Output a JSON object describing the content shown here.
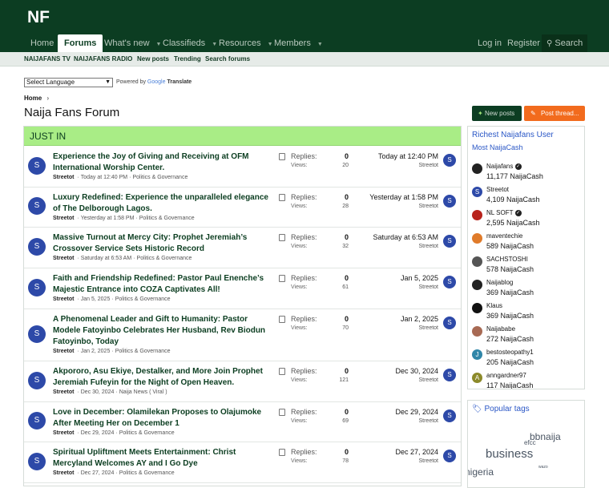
{
  "logo": "NF",
  "nav": {
    "home": "Home",
    "forums": "Forums",
    "whats_new": "What's new",
    "classifieds": "Classifieds",
    "resources": "Resources",
    "members": "Members",
    "login": "Log in",
    "register": "Register",
    "search": "Search"
  },
  "subnav": [
    "NAIJAFANS TV",
    "NAIJAFANS RADIO",
    "New posts",
    "Trending",
    "Search forums"
  ],
  "language": {
    "selected": "Select Language",
    "powered": "Powered by",
    "google": "Google",
    "translate": "Translate"
  },
  "breadcrumb": "Home",
  "page_title": "Naija Fans Forum",
  "buttons": {
    "new_posts": "New posts",
    "post_thread": "Post thread..."
  },
  "block_title": "JUST IN",
  "labels": {
    "replies": "Replies:",
    "views": "Views:"
  },
  "threads": [
    {
      "title": "Experience the Joy of Giving and Receiving at OFM International Worship Center.",
      "author": "Streetot",
      "date": "Today at 12:40 PM",
      "forum": "Politics & Governance",
      "replies": "0",
      "views": "20",
      "last": "Today at 12:40 PM",
      "last_user": "Streetot",
      "avatar": "S"
    },
    {
      "title": "Luxury Redefined: Experience the unparalleled elegance of The Delborough Lagos.",
      "author": "Streetot",
      "date": "Yesterday at 1:58 PM",
      "forum": "Politics & Governance",
      "replies": "0",
      "views": "28",
      "last": "Yesterday at 1:58 PM",
      "last_user": "Streetot",
      "avatar": "S"
    },
    {
      "title": "Massive Turnout at Mercy City: Prophet Jeremiah’s Crossover Service Sets Historic Record",
      "author": "Streetot",
      "date": "Saturday at 6:53 AM",
      "forum": "Politics & Governance",
      "replies": "0",
      "views": "32",
      "last": "Saturday at 6:53 AM",
      "last_user": "Streetot",
      "avatar": "S"
    },
    {
      "title": "Faith and Friendship Redefined: Pastor Paul Enenche’s Majestic Entrance into COZA Captivates All!",
      "author": "Streetot",
      "date": "Jan 5, 2025",
      "forum": "Politics & Governance",
      "replies": "0",
      "views": "61",
      "last": "Jan 5, 2025",
      "last_user": "Streetot",
      "avatar": "S"
    },
    {
      "title": "A Phenomenal Leader and Gift to Humanity: Pastor Modele Fatoyinbo Celebrates Her Husband, Rev Biodun Fatoyinbo, Today",
      "author": "Streetot",
      "date": "Jan 2, 2025",
      "forum": "Politics & Governance",
      "replies": "0",
      "views": "70",
      "last": "Jan 2, 2025",
      "last_user": "Streetot",
      "avatar": "S"
    },
    {
      "title": "Akpororo, Asu Ekiye, Destalker, and More Join Prophet Jeremiah Fufeyin for the Night of Open Heaven.",
      "author": "Streetot",
      "date": "Dec 30, 2024",
      "forum": "Naija News ( Viral )",
      "replies": "0",
      "views": "121",
      "last": "Dec 30, 2024",
      "last_user": "Streetot",
      "avatar": "S"
    },
    {
      "title": "Love in December: Olamilekan Proposes to Olajumoke After Meeting Her on December 1",
      "author": "Streetot",
      "date": "Dec 29, 2024",
      "forum": "Politics & Governance",
      "replies": "0",
      "views": "69",
      "last": "Dec 29, 2024",
      "last_user": "Streetot",
      "avatar": "S"
    },
    {
      "title": "Spiritual Upliftment Meets Entertainment: Christ Mercyland Welcomes AY and I Go Dye",
      "author": "Streetot",
      "date": "Dec 27, 2024",
      "forum": "Politics & Governance",
      "replies": "0",
      "views": "78",
      "last": "Dec 27, 2024",
      "last_user": "Streetot",
      "avatar": "S"
    }
  ],
  "sidebar": {
    "title": "Richest Naijafans User",
    "subtitle": "Most NaijaCash",
    "users": [
      {
        "name": "Naijafans",
        "cash": "11,177 NaijaCash",
        "verified": true,
        "avatar_color": "#222"
      },
      {
        "name": "Streetot",
        "cash": "4,109 NaijaCash",
        "verified": false,
        "avatar_color": "#2d49a8",
        "letter": "S"
      },
      {
        "name": "NL SOFT",
        "cash": "2,595 NaijaCash",
        "verified": true,
        "avatar_color": "#b8231c"
      },
      {
        "name": "maventechie",
        "cash": "589 NaijaCash",
        "verified": false,
        "avatar_color": "#e07b2a"
      },
      {
        "name": "SACHSTOSHI",
        "cash": "578 NaijaCash",
        "verified": false,
        "avatar_color": "#555"
      },
      {
        "name": "Naijablog",
        "cash": "369 NaijaCash",
        "verified": false,
        "avatar_color": "#222"
      },
      {
        "name": "Klaus",
        "cash": "369 NaijaCash",
        "verified": false,
        "avatar_color": "#111"
      },
      {
        "name": "Naijababe",
        "cash": "272 NaijaCash",
        "verified": false,
        "avatar_color": "#a86a54"
      },
      {
        "name": "bestosteopathy1",
        "cash": "205 NaijaCash",
        "verified": false,
        "avatar_color": "#2f86a8",
        "letter": "J"
      },
      {
        "name": "anngardner97",
        "cash": "117 NaijaCash",
        "verified": false,
        "avatar_color": "#8c8a2a",
        "letter": "A"
      }
    ]
  },
  "tags": {
    "title": "Popular tags",
    "items": [
      "bbnaija",
      "efcc",
      "business",
      "wazo",
      "nigeria"
    ]
  }
}
